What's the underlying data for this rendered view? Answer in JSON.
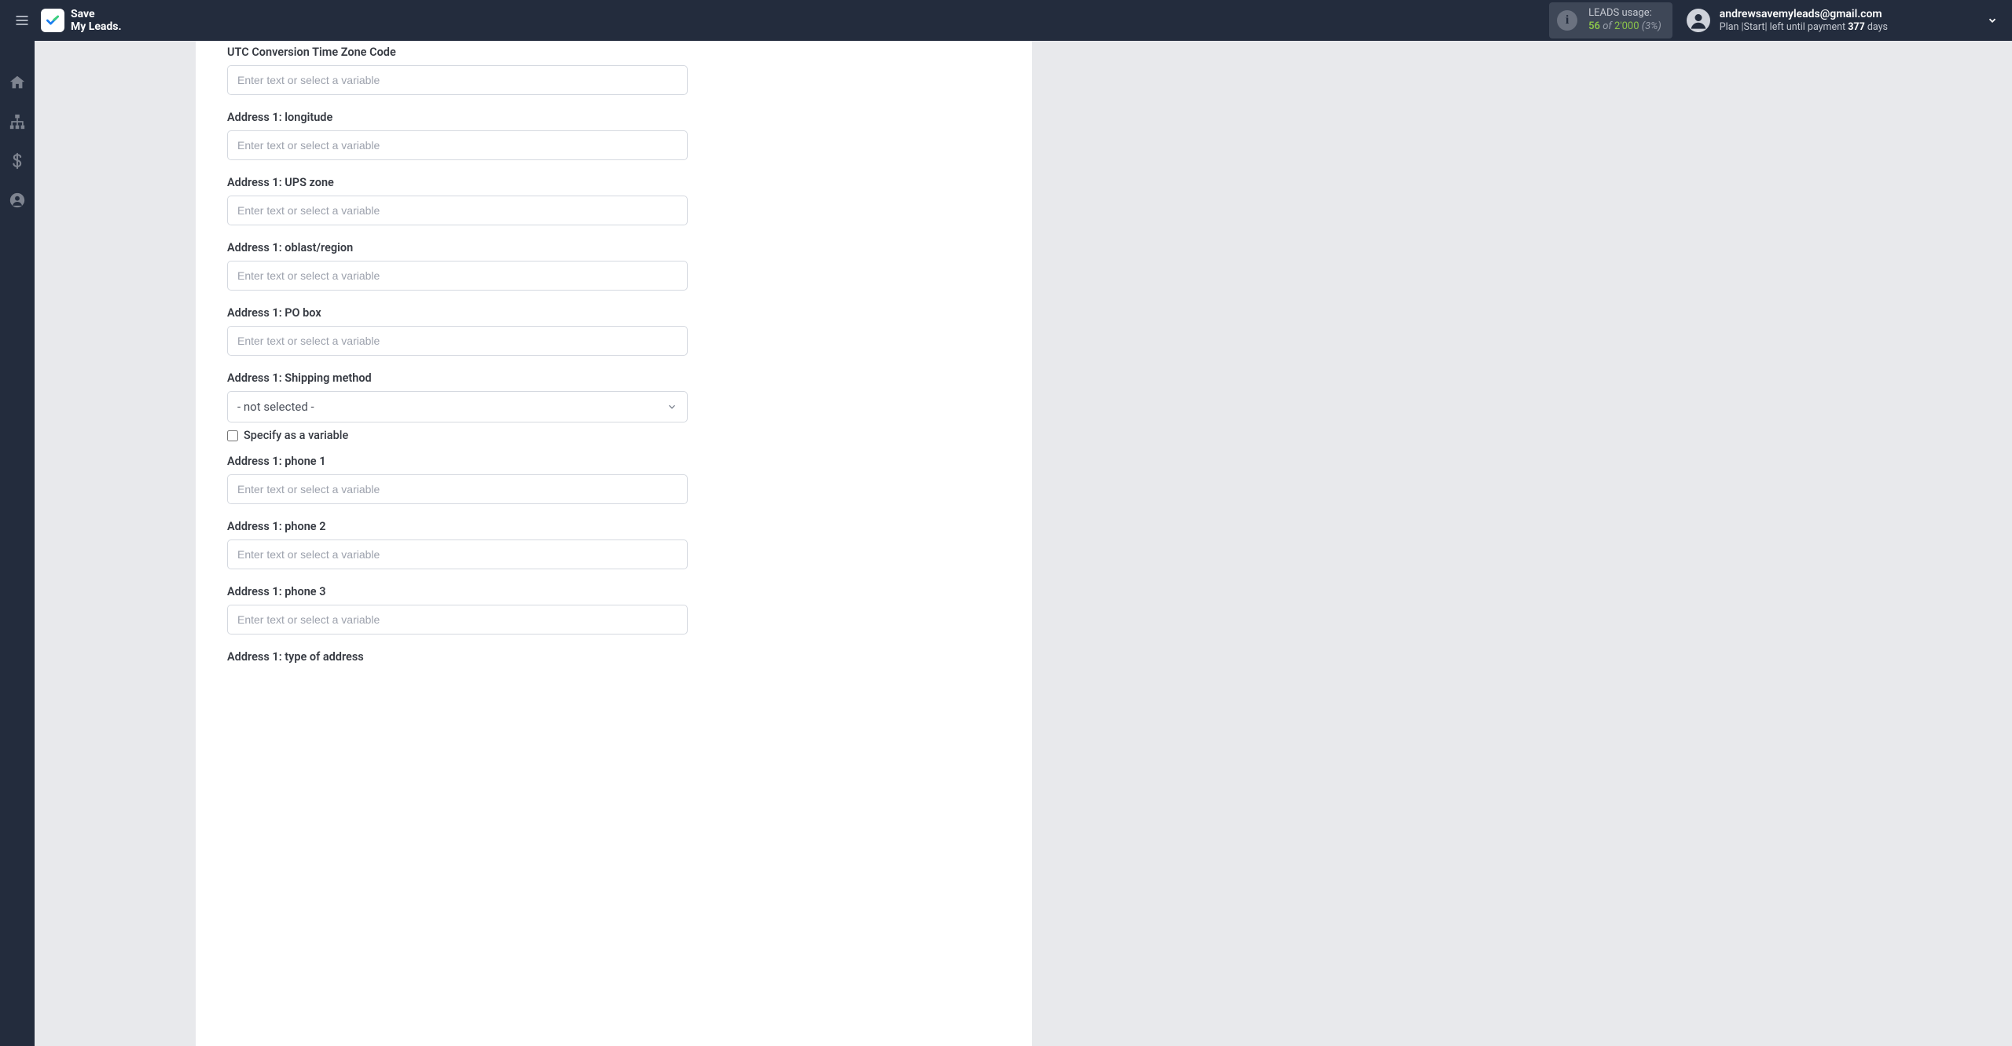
{
  "header": {
    "logo_line1": "Save",
    "logo_line2": "My Leads.",
    "usage": {
      "label": "LEADS usage:",
      "used": "56",
      "of": "of",
      "total": "2'000",
      "pct": "(3%)"
    },
    "user": {
      "email": "andrewsavemyleads@gmail.com",
      "plan_prefix": "Plan |Start| left until payment ",
      "plan_days": "377",
      "plan_suffix": " days"
    }
  },
  "form": {
    "placeholder": "Enter text or select a variable",
    "fields": [
      {
        "label": "UTC Conversion Time Zone Code",
        "type": "text"
      },
      {
        "label": "Address 1: longitude",
        "type": "text"
      },
      {
        "label": "Address 1: UPS zone",
        "type": "text"
      },
      {
        "label": "Address 1: oblast/region",
        "type": "text"
      },
      {
        "label": "Address 1: PO box",
        "type": "text"
      },
      {
        "label": "Address 1: Shipping method",
        "type": "select",
        "selected": " - not selected - ",
        "checkbox_label": "Specify as a variable"
      },
      {
        "label": "Address 1: phone 1",
        "type": "text"
      },
      {
        "label": "Address 1: phone 2",
        "type": "text"
      },
      {
        "label": "Address 1: phone 3",
        "type": "text"
      },
      {
        "label": "Address 1: type of address",
        "type": "text_label_only"
      }
    ]
  }
}
